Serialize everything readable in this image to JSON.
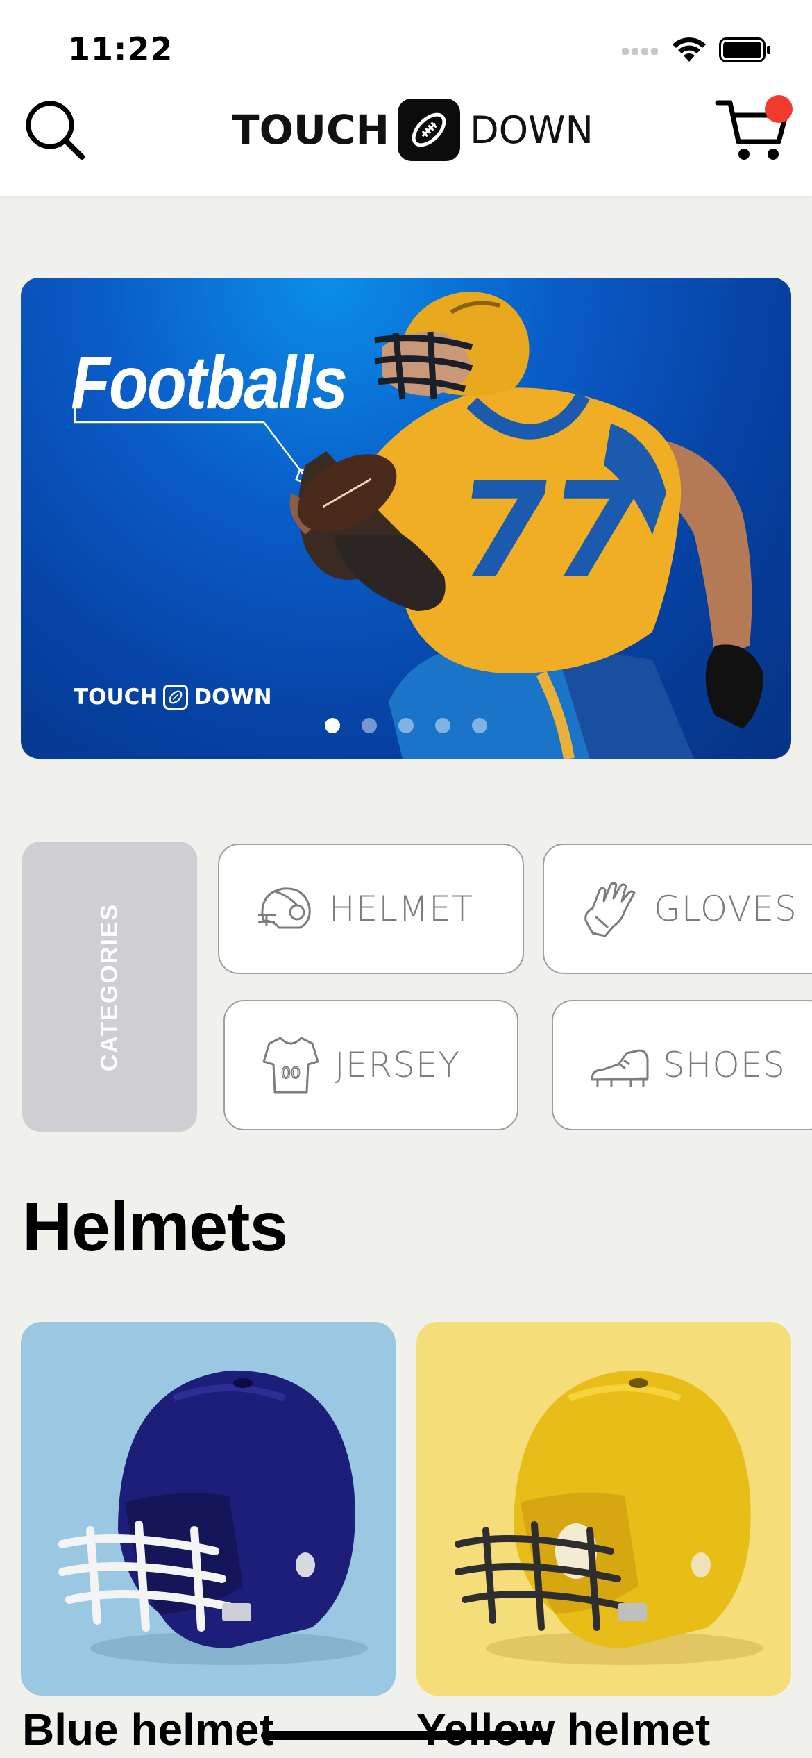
{
  "status_bar": {
    "time": "11:22"
  },
  "header": {
    "logo_left": "TOUCH",
    "logo_right": "DOWN"
  },
  "hero": {
    "title": "Footballs",
    "brand_left": "TOUCH",
    "brand_right": "DOWN",
    "jersey_number": "77",
    "slides": 5,
    "active_slide": 1
  },
  "categories": {
    "label": "CATEGORIES",
    "items": [
      {
        "label": "HELMET",
        "icon": "helmet-icon"
      },
      {
        "label": "GLOVES",
        "icon": "gloves-icon"
      },
      {
        "label": "JERSEY",
        "icon": "jersey-icon"
      },
      {
        "label": "SHOES",
        "icon": "cleat-shoe-icon"
      }
    ]
  },
  "section": {
    "title": "Helmets",
    "products": [
      {
        "name": "Blue helmet",
        "bg": "#9AC8E3",
        "shell": "#1d1d7a"
      },
      {
        "name": "Yellow helmet",
        "bg": "#F5DD7A",
        "shell": "#e9bd18"
      }
    ]
  },
  "colors": {
    "badge": "#F13B30",
    "background": "#F0F1EC",
    "hero_blue": "#0a5cc8"
  },
  "jersey_icon_number": "00"
}
